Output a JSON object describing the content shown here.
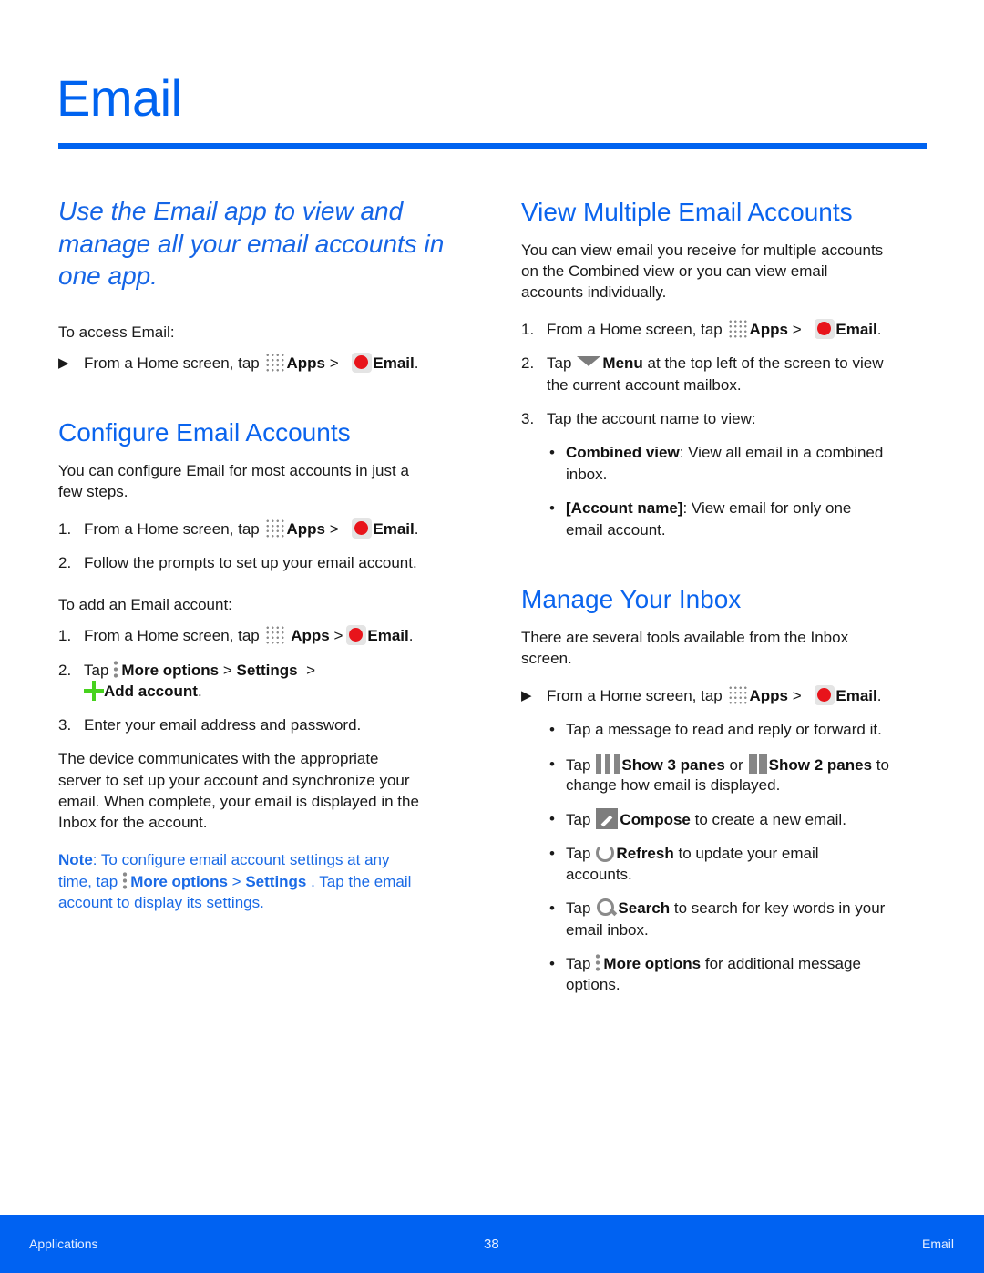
{
  "page": {
    "title": "Email",
    "intro": "Use the Email app to view and manage all your email accounts in one app."
  },
  "common": {
    "apps": "Apps",
    "email": "Email",
    "more_options": "More options",
    "settings": "Settings",
    "from_home": "From a Home screen, tap",
    "tap": "Tap",
    "gt": ">",
    "period": "."
  },
  "left": {
    "access_label": "To access Email:",
    "configure": {
      "heading": "Configure Email Accounts",
      "desc_line1": "You can configure Email for most accounts in just a",
      "desc_line2": "few steps.",
      "step2": "Follow the prompts to set up your email account.",
      "add_label": "To add an Email account:",
      "add_account": "Add account",
      "step3": "Enter your email address and password.",
      "para": [
        "The device communicates with the appropriate",
        "server to set up your account and synchronize your",
        "email. When complete, your email is displayed in the",
        "Inbox for the account."
      ],
      "note_label": "Note",
      "note_line1": ": To configure email account settings at any",
      "note_line2_pre": "time, tap",
      "note_line2_post": ". Tap the email",
      "note_line3": "account to display its settings."
    }
  },
  "right": {
    "multiple": {
      "heading": "View Multiple Email Accounts",
      "desc": [
        "You can view email you receive for multiple accounts",
        "on the Combined view or you can view email",
        "accounts individually."
      ],
      "menu": "Menu",
      "step2_post": "at the top left of the screen to view",
      "step2_line2": "the current account mailbox.",
      "step3": "Tap the account name to view:",
      "combined_label": "Combined view",
      "combined_text": ": View all email in a combined",
      "combined_line2": "inbox.",
      "account_label": "[Account name]",
      "account_text": ": View email for only one",
      "account_line2": "email account."
    },
    "inbox": {
      "heading": "Manage Your Inbox",
      "desc": [
        "There are several tools available from the Inbox",
        "screen."
      ],
      "b1": "Tap a message to read and reply or forward it.",
      "show3": "Show 3 panes",
      "or": "or",
      "show2": "Show 2 panes",
      "to": "to",
      "b2_line2": "change how email is displayed.",
      "compose": "Compose",
      "compose_text": "to create a new email.",
      "refresh": "Refresh",
      "refresh_text": "to update your email",
      "refresh_line2": "accounts.",
      "search": "Search",
      "search_text": "to search for key words in your",
      "search_line2": "email inbox.",
      "more_text": "for additional message",
      "more_line2": "options."
    }
  },
  "footer": {
    "left": "Applications",
    "page_number": "38",
    "right": "Email"
  },
  "colors": {
    "accent": "#0063f0",
    "footer_bg": "#0062f2",
    "email_icon": "#e8141b",
    "add_icon": "#47d21e"
  }
}
